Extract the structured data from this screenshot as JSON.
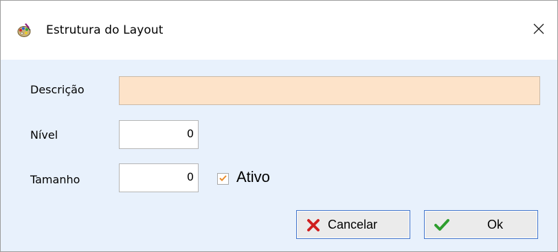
{
  "window": {
    "title": "Estrutura do Layout",
    "app_icon": "palette-icon",
    "close_icon": "close-icon"
  },
  "form": {
    "descricao_label": "Descrição",
    "descricao_value": "",
    "nivel_label": "Nível",
    "nivel_value": "0",
    "tamanho_label": "Tamanho",
    "tamanho_value": "0",
    "ativo_label": "Ativo",
    "ativo_checked": true
  },
  "buttons": {
    "cancel_label": "Cancelar",
    "cancel_icon": "x-icon",
    "ok_label": "Ok",
    "ok_icon": "checkmark-icon"
  },
  "colors": {
    "description_field_bg": "#fde3c9",
    "dialog_bg": "#e8f1fc",
    "cancel_icon": "#d01f1f",
    "ok_icon": "#2e9e2e",
    "checkbox_tick": "#e98a2a",
    "button_border": "#3f72c9"
  }
}
